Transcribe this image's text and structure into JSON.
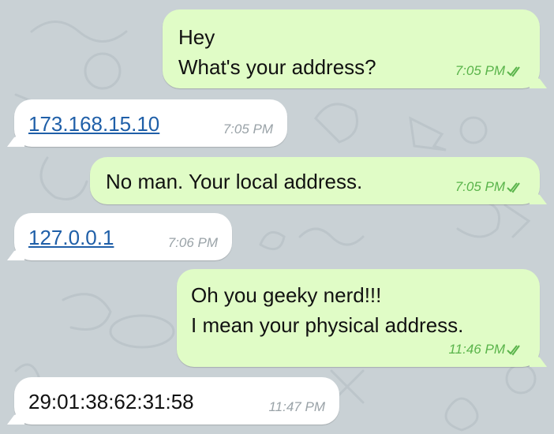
{
  "colors": {
    "wallpaper": "#c9d1d5",
    "outgoing_bubble": "#e0fcc6",
    "incoming_bubble": "#ffffff",
    "outgoing_time": "#5ab44b",
    "incoming_time": "#9aa3a8",
    "link": "#1f5fa8"
  },
  "messages": [
    {
      "direction": "outgoing",
      "lines": [
        "Hey",
        "What's your address?"
      ],
      "time": "7:05 PM",
      "status_icon": "double-check-icon"
    },
    {
      "direction": "incoming",
      "lines": [
        "173.168.15.10"
      ],
      "is_link": true,
      "time": "7:05 PM"
    },
    {
      "direction": "outgoing",
      "lines": [
        "No man. Your local address."
      ],
      "time": "7:05 PM",
      "status_icon": "double-check-icon"
    },
    {
      "direction": "incoming",
      "lines": [
        "127.0.0.1"
      ],
      "is_link": true,
      "time": "7:06 PM"
    },
    {
      "direction": "outgoing",
      "lines": [
        "Oh you geeky nerd!!!",
        "I mean your physical address."
      ],
      "time": "11:46 PM",
      "status_icon": "double-check-icon"
    },
    {
      "direction": "incoming",
      "lines": [
        "29:01:38:62:31:58"
      ],
      "time": "11:47 PM"
    }
  ]
}
